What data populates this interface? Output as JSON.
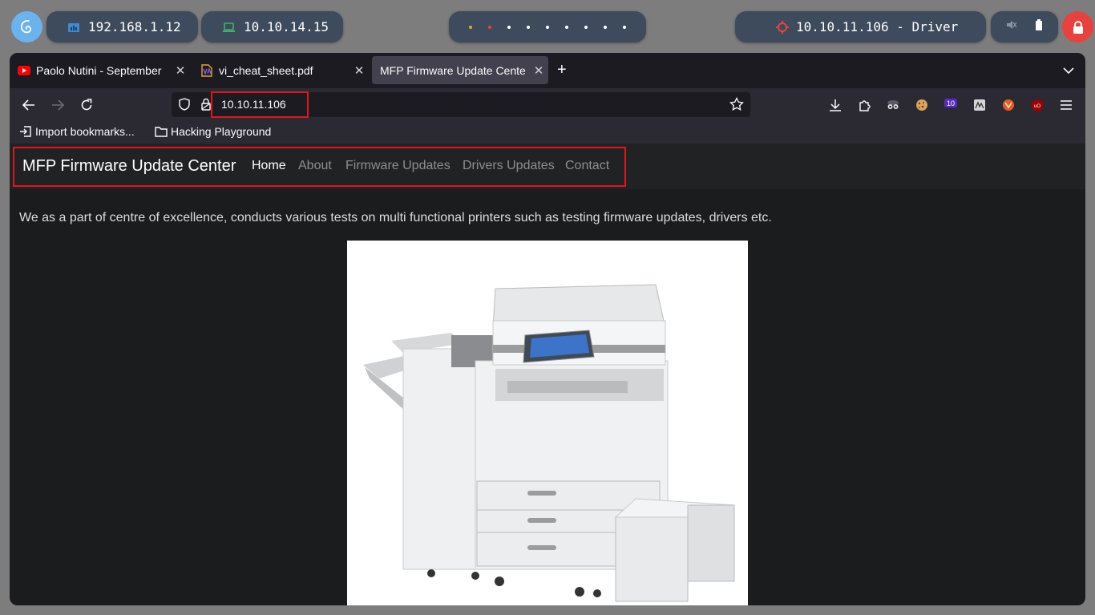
{
  "taskbar": {
    "local_ip": "192.168.1.12",
    "vpn_ip": "10.10.14.15",
    "target": "10.10.11.106 - Driver",
    "colors": {
      "pill": "#3d4b5c",
      "logo": "#6ab3ee",
      "lock": "#e8423f",
      "target_icon": "#e8423f",
      "network_icon": "#3b8bd4",
      "vpn_icon": "#3db36b"
    }
  },
  "browser": {
    "tabs": [
      {
        "title": "Paolo Nutini - September",
        "favicon": "youtube-icon",
        "active": false
      },
      {
        "title": "vi_cheat_sheet.pdf",
        "favicon": "pdf-icon",
        "active": false
      },
      {
        "title": "MFP Firmware Update Cente",
        "favicon": "none",
        "active": true
      }
    ],
    "url": "10.10.11.106",
    "extension_badge": "10",
    "bookmarks": [
      {
        "label": "Import bookmarks...",
        "icon": "import-icon"
      },
      {
        "label": "Hacking Playground",
        "icon": "folder-icon"
      }
    ]
  },
  "site": {
    "brand": "MFP Firmware Update Center",
    "menu": [
      "Home",
      "About",
      "Firmware Updates",
      "Drivers Updates",
      "Contact"
    ],
    "active_menu": "Home",
    "intro": "We as a part of centre of excellence, conducts various tests on multi functional printers such as testing firmware updates, drivers etc.",
    "image": "multifunction-printer-image"
  },
  "annotations": {
    "highlight_color": "#e0161e"
  }
}
